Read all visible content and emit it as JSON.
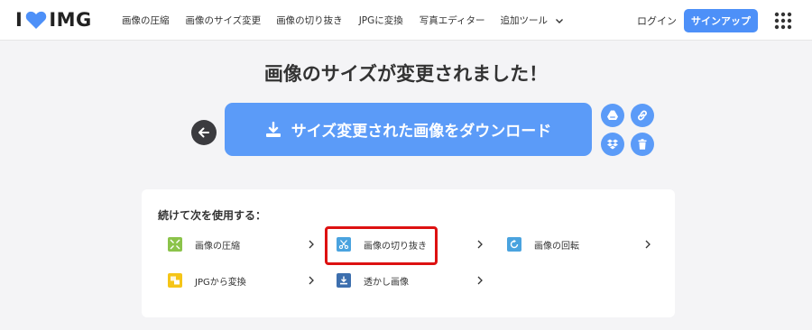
{
  "header": {
    "logo_left": "I",
    "logo_right": "IMG",
    "nav": [
      {
        "label": "画像の圧縮"
      },
      {
        "label": "画像のサイズ変更"
      },
      {
        "label": "画像の切り抜き"
      },
      {
        "label": "JPGに変換"
      },
      {
        "label": "写真エディター"
      },
      {
        "label": "追加ツール"
      }
    ],
    "login": "ログイン",
    "signup": "サインアップ"
  },
  "main": {
    "headline": "画像のサイズが変更されました！",
    "download_label": "サイズ変更された画像をダウンロード"
  },
  "continue": {
    "title": "続けて次を使用する：",
    "tools": [
      {
        "label": "画像の圧縮",
        "icon": "compress-icon",
        "color": "#8bc34a"
      },
      {
        "label": "画像の切り抜き",
        "icon": "crop-icon",
        "color": "#4aa3df"
      },
      {
        "label": "画像の回転",
        "icon": "rotate-icon",
        "color": "#4aa3df"
      },
      {
        "label": "JPGから変換",
        "icon": "convert-from-jpg-icon",
        "color": "#f5c518"
      },
      {
        "label": "透かし画像",
        "icon": "watermark-icon",
        "color": "#3d6fae"
      }
    ]
  },
  "colors": {
    "accent": "#5b9bf8",
    "highlight": "#dd1111"
  }
}
